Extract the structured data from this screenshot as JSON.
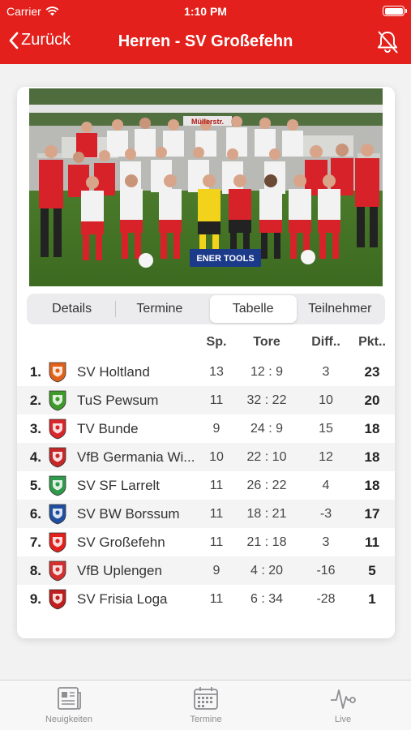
{
  "status_bar": {
    "carrier": "Carrier",
    "time": "1:10 PM"
  },
  "nav": {
    "back_label": "Zurück",
    "title": "Herren - SV Großefehn"
  },
  "photo": {
    "sponsor_banner": "ENER TOOLS",
    "back_banner": "Müllerstr."
  },
  "tabs": [
    {
      "label": "Details",
      "active": false
    },
    {
      "label": "Termine",
      "active": false
    },
    {
      "label": "Tabelle",
      "active": true
    },
    {
      "label": "Teilnehmer",
      "active": false
    }
  ],
  "table": {
    "headers": {
      "sp": "Sp.",
      "tore": "Tore",
      "diff": "Diff..",
      "pkt": "Pkt.."
    },
    "rows": [
      {
        "rank": "1.",
        "team": "SV Holtland",
        "sp": "13",
        "tore": "12 : 9",
        "diff": "3",
        "pkt": "23",
        "logo_icon": "holtland-crest-icon",
        "logo_color": "#e0621a"
      },
      {
        "rank": "2.",
        "team": "TuS Pewsum",
        "sp": "11",
        "tore": "32 : 22",
        "diff": "10",
        "pkt": "20",
        "logo_icon": "pewsum-crest-icon",
        "logo_color": "#3f9a2a"
      },
      {
        "rank": "3.",
        "team": "TV Bunde",
        "sp": "9",
        "tore": "24 : 9",
        "diff": "15",
        "pkt": "18",
        "logo_icon": "bunde-crest-icon",
        "logo_color": "#d8262b"
      },
      {
        "rank": "4.",
        "team": "VfB Germania Wi...",
        "sp": "10",
        "tore": "22 : 10",
        "diff": "12",
        "pkt": "18",
        "logo_icon": "germania-crest-icon",
        "logo_color": "#c62828"
      },
      {
        "rank": "5.",
        "team": "SV SF Larrelt",
        "sp": "11",
        "tore": "26 : 22",
        "diff": "4",
        "pkt": "18",
        "logo_icon": "larrelt-crest-icon",
        "logo_color": "#2e9a4a"
      },
      {
        "rank": "6.",
        "team": "SV BW Borssum",
        "sp": "11",
        "tore": "18 : 21",
        "diff": "-3",
        "pkt": "17",
        "logo_icon": "borssum-crest-icon",
        "logo_color": "#1f4fa0"
      },
      {
        "rank": "7.",
        "team": "SV Großefehn",
        "sp": "11",
        "tore": "21 : 18",
        "diff": "3",
        "pkt": "11",
        "logo_icon": "grossefehn-crest-icon",
        "logo_color": "#e3201b"
      },
      {
        "rank": "8.",
        "team": "VfB Uplengen",
        "sp": "9",
        "tore": "4 : 20",
        "diff": "-16",
        "pkt": "5",
        "logo_icon": "uplengen-crest-icon",
        "logo_color": "#d32f2f"
      },
      {
        "rank": "9.",
        "team": "SV Frisia Loga",
        "sp": "11",
        "tore": "6 : 34",
        "diff": "-28",
        "pkt": "1",
        "logo_icon": "frisia-loga-crest-icon",
        "logo_color": "#c21d1d"
      }
    ]
  },
  "tabbar": [
    {
      "label": "Neuigkeiten",
      "icon": "newspaper-icon"
    },
    {
      "label": "Termine",
      "icon": "calendar-icon"
    },
    {
      "label": "Live",
      "icon": "pulse-icon"
    }
  ],
  "colors": {
    "brand": "#e3201b",
    "tab_inactive": "#8e8e93"
  }
}
